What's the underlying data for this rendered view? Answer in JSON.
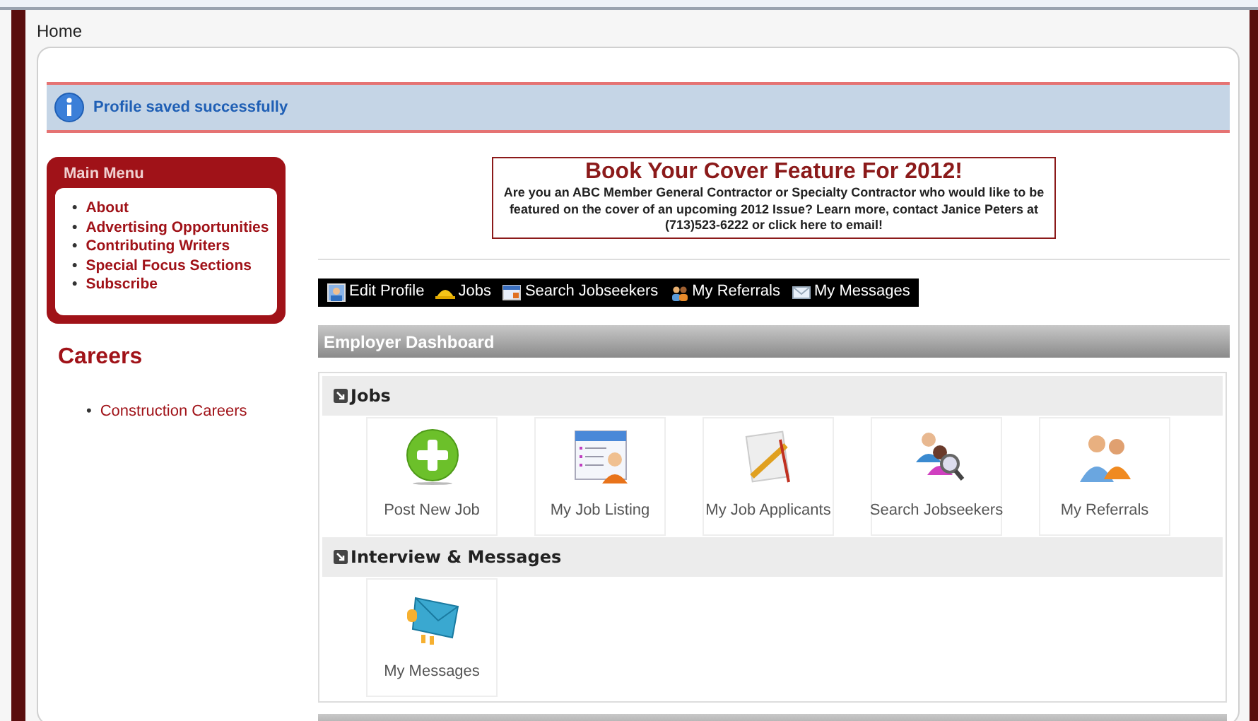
{
  "breadcrumb": "Home",
  "alert": {
    "text": "Profile saved successfully"
  },
  "main_menu": {
    "title": "Main Menu",
    "bullet": "•",
    "items": [
      "About",
      "Advertising Opportunities",
      "Contributing Writers",
      "Special Focus Sections",
      "Subscribe"
    ]
  },
  "careers": {
    "title": "Careers",
    "bullet": "•",
    "items": [
      "Construction Careers"
    ]
  },
  "banner": {
    "title": "Book Your Cover Feature For 2012!",
    "text": "Are you an ABC Member General Contractor or Specialty Contractor who would like to be featured on the cover of an upcoming 2012 Issue?  Learn more, contact Janice Peters at (713)523-6222 or click here to email!"
  },
  "toolbar": [
    {
      "label": "Edit Profile",
      "kind": "profile"
    },
    {
      "label": "Jobs",
      "kind": "hardhat"
    },
    {
      "label": "Search Jobseekers",
      "kind": "card"
    },
    {
      "label": "My Referrals",
      "kind": "people"
    },
    {
      "label": "My Messages",
      "kind": "envelope"
    }
  ],
  "dashboard": {
    "title": "Employer Dashboard",
    "sections": [
      {
        "title": "Jobs",
        "tiles": [
          {
            "label": "Post New Job",
            "kind": "plus"
          },
          {
            "label": "My Job Listing",
            "kind": "listing"
          },
          {
            "label": "My Job Applicants",
            "kind": "tools"
          },
          {
            "label": "Search Jobseekers",
            "kind": "search"
          },
          {
            "label": "My Referrals",
            "kind": "people"
          }
        ]
      },
      {
        "title": "Interview & Messages",
        "tiles": [
          {
            "label": "My Messages",
            "kind": "envelope"
          }
        ]
      }
    ]
  }
}
